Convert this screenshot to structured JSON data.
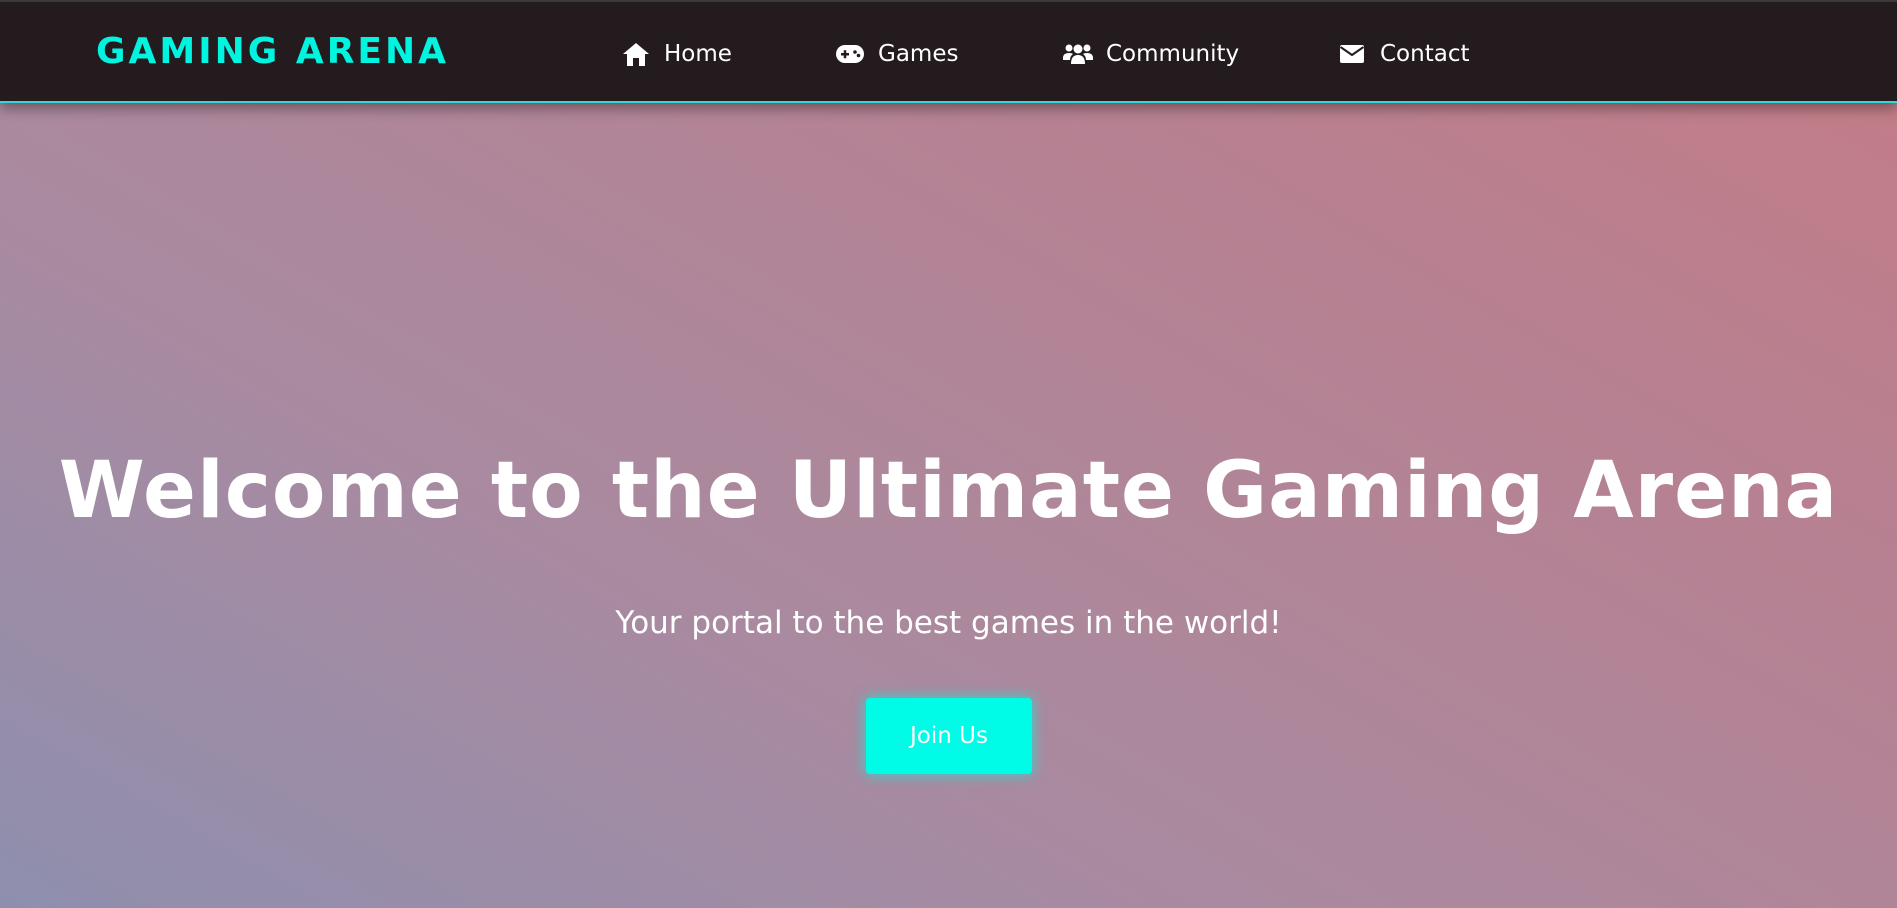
{
  "header": {
    "logo": "GAMING ARENA",
    "nav": [
      {
        "label": "Home",
        "icon": "home-icon"
      },
      {
        "label": "Games",
        "icon": "gamepad-icon"
      },
      {
        "label": "Community",
        "icon": "users-icon"
      },
      {
        "label": "Contact",
        "icon": "envelope-icon"
      }
    ]
  },
  "hero": {
    "title": "Welcome to the Ultimate Gaming Arena",
    "subtitle": "Your portal to the best games in the world!",
    "cta_label": "Join Us"
  },
  "colors": {
    "accent": "#00f5e1",
    "navbar_bg": "#241b1f",
    "text": "#ffffff"
  }
}
